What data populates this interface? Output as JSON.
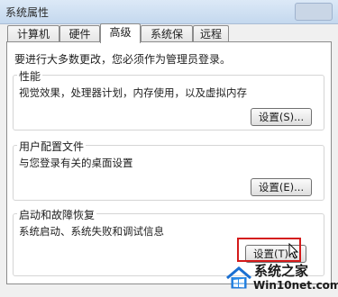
{
  "window": {
    "title": "系统属性"
  },
  "tabs": [
    {
      "label": "计算机名"
    },
    {
      "label": "硬件"
    },
    {
      "label": "高级"
    },
    {
      "label": "系统保护"
    },
    {
      "label": "远程"
    }
  ],
  "admin_note": "要进行大多数更改，您必须作为管理员登录。",
  "groups": {
    "performance": {
      "title": "性能",
      "description": "视觉效果，处理器计划，内存使用，以及虚拟内存",
      "button": "设置(S)..."
    },
    "user_profiles": {
      "title": "用户配置文件",
      "description": "与您登录有关的桌面设置",
      "button": "设置(E)..."
    },
    "startup_recovery": {
      "title": "启动和故障恢复",
      "description": "系统启动、系统失败和调试信息",
      "button": "设置(T)..."
    }
  },
  "watermark": {
    "text": "系统之家",
    "domain": "Win10net.com"
  },
  "colors": {
    "highlight": "#d41a1a",
    "tab_border": "#8c8c8c",
    "titlebar": "#c4d8ee"
  }
}
